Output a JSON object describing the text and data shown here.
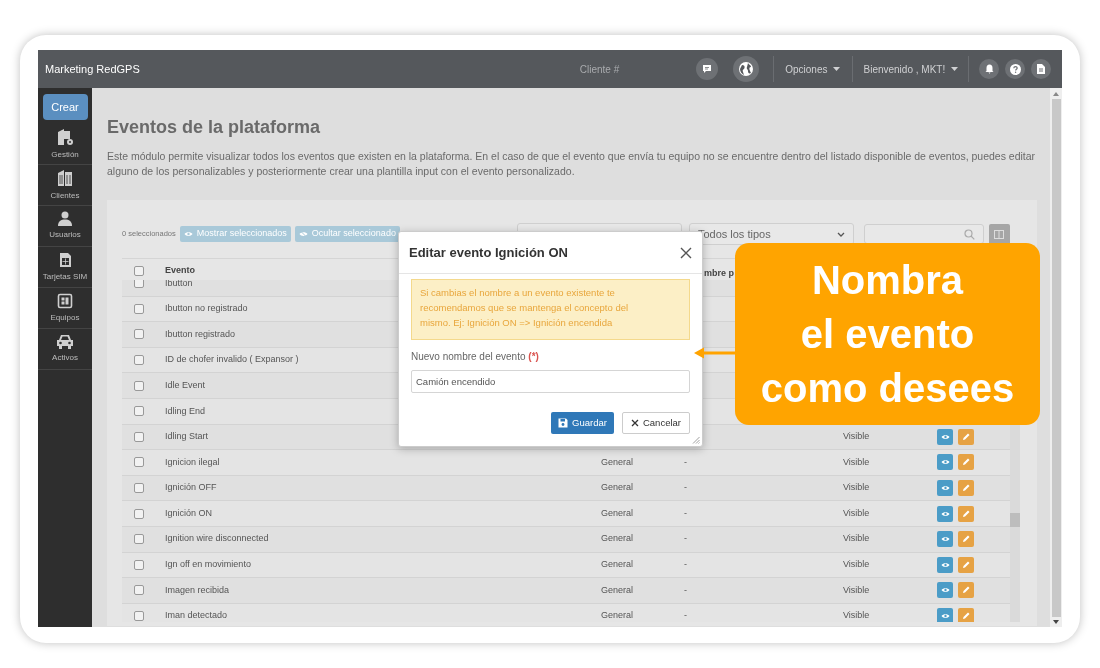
{
  "topbar": {
    "title": "Marketing RedGPS",
    "client": "Cliente #",
    "options": "Opciones",
    "welcome": "Bienvenido , MKT!"
  },
  "sidebar": {
    "create": "Crear",
    "items": [
      {
        "label": "Gestión"
      },
      {
        "label": "Clientes"
      },
      {
        "label": "Usuarios"
      },
      {
        "label": "Tarjetas SIM"
      },
      {
        "label": "Equipos"
      },
      {
        "label": "Activos"
      }
    ]
  },
  "page": {
    "title": "Eventos de la plataforma",
    "description": "Este módulo permite visualizar todos los eventos que existen en la plataforma. En el caso de que el evento que envía tu equipo no se encuentre dentro del listado disponible de eventos, puedes editar alguno de los personalizables y posteriormente crear una plantilla input con el evento personalizado."
  },
  "toolbar": {
    "selected_count": "0 seleccionados",
    "show_button": "Mostrar seleccionados",
    "hide_button": "Ocultar seleccionado",
    "type_filter": "Todos los tipos"
  },
  "table": {
    "header_checked": false,
    "columns": [
      "Evento",
      "mbre p"
    ],
    "rows": [
      {
        "event": "Ibutton",
        "checked": false,
        "actions": false
      },
      {
        "event": "Ibutton no registrado",
        "checked": false,
        "actions": false
      },
      {
        "event": "Ibutton registrado",
        "checked": false,
        "actions": false
      },
      {
        "event": "ID de chofer invalido ( Expansor )",
        "checked": false,
        "actions": false
      },
      {
        "event": "Idle Event",
        "checked": false,
        "actions": false
      },
      {
        "event": "Idling End",
        "checked": false,
        "actions": false
      },
      {
        "event": "Idling Start",
        "visibility": "Visible",
        "checked": false,
        "actions": true
      },
      {
        "event": "Ignicion ilegal",
        "type": "General",
        "custom_name": "-",
        "visibility": "Visible",
        "checked": false,
        "actions": true
      },
      {
        "event": "Ignición OFF",
        "type": "General",
        "custom_name": "-",
        "visibility": "Visible",
        "checked": false,
        "actions": true
      },
      {
        "event": "Ignición ON",
        "type": "General",
        "custom_name": "-",
        "visibility": "Visible",
        "checked": false,
        "actions": true
      },
      {
        "event": "Ignition wire disconnected",
        "type": "General",
        "custom_name": "-",
        "visibility": "Visible",
        "checked": false,
        "actions": true
      },
      {
        "event": "Ign off en movimiento",
        "type": "General",
        "custom_name": "-",
        "visibility": "Visible",
        "checked": false,
        "actions": true
      },
      {
        "event": "Imagen recibida",
        "type": "General",
        "custom_name": "-",
        "visibility": "Visible",
        "checked": false,
        "actions": true
      },
      {
        "event": "Iman detectado",
        "type": "General",
        "custom_name": "-",
        "visibility": "Visible",
        "checked": false,
        "actions": true
      }
    ]
  },
  "modal": {
    "title": "Editar evento Ignición ON",
    "alert": "Si cambias el nombre a un evento existente te recomendamos que se mantenga el concepto del mismo. Ej: Ignición ON => Ignición encendida",
    "label": "Nuevo nombre del evento",
    "required_mark": "(*)",
    "value": "Camión encendido",
    "save": "Guardar",
    "cancel": "Cancelar"
  },
  "callout": {
    "lines": [
      "Nombra",
      "el evento",
      "como desees"
    ]
  }
}
